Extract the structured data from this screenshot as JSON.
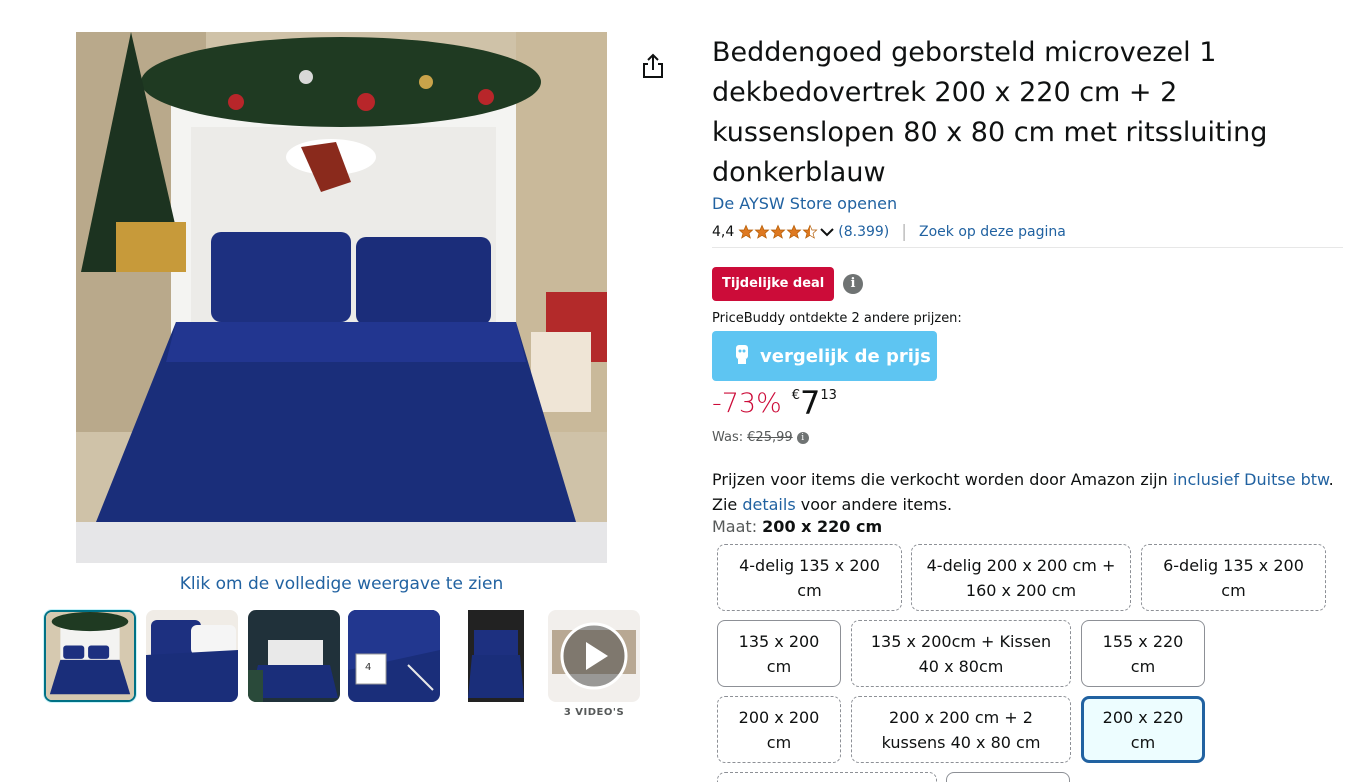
{
  "product": {
    "title": "Beddengoed geborsteld microvezel 1 dekbedovertrek 200 x 220 cm + 2 kussenslopen 80 x 80 cm met ritssluiting donkerblauw",
    "store_link": "De AYSW Store openen",
    "rating_value": "4,4",
    "rating_count": "(8.399)",
    "search_page_link": "Zoek op deze pagina"
  },
  "gallery": {
    "zoom_hint": "Klik om de volledige weergave te zien",
    "video_count": "3 VIDEO'S",
    "thumb_box_label": "4"
  },
  "deal": {
    "badge": "Tijdelijke deal",
    "pricebuddy_text": "PriceBuddy ontdekte 2 andere prijzen:",
    "pricebuddy_button": "vergelijk de prijs"
  },
  "price": {
    "discount": "-73%",
    "currency": "€",
    "whole": "7",
    "fraction": "13",
    "was_label": "Was:",
    "was_price": "€25,99"
  },
  "tax": {
    "part1": "Prijzen voor items die verkocht worden door Amazon zijn ",
    "link1": "inclusief Duitse btw",
    "part2": ". Zie ",
    "link2": "details",
    "part3": " voor andere items."
  },
  "size": {
    "label": "Maat:",
    "selected": "200 x 220 cm",
    "options": [
      "4-delig 135 x 200 cm",
      "4-delig 200 x 200 cm + 160 x 200 cm",
      "6-delig 135 x 200 cm",
      "135 x 200 cm",
      "135 x 200cm + Kissen 40 x 80cm",
      "155 x 220 cm",
      "200 x 200 cm",
      "200 x 200 cm + 2 kussens 40 x 80 cm",
      "200 x 220 cm"
    ]
  },
  "colors": {
    "link": "#2162a1",
    "deal": "#cc0c39",
    "pricebuddy": "#5ec5f2",
    "star": "#de7921",
    "bedding": "#1a2e7a"
  },
  "icons": {
    "share": "share-icon",
    "info": "info-icon",
    "star": "star-icon",
    "chevron": "chevron-down-icon",
    "play": "play-icon"
  }
}
